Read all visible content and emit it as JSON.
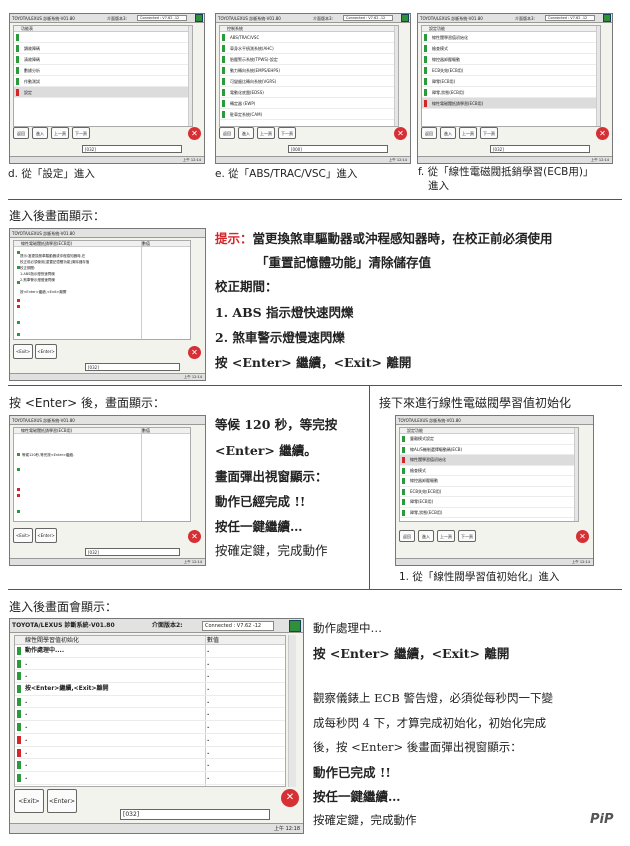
{
  "top_row": {
    "screen_title": "TOYOTA/LEXUS 診斷系統-V01.80",
    "screen_ver_label": "介面版本3:",
    "screen_conn": "Connected : V7.62 -12",
    "screen_d": {
      "header": "功能表",
      "rows": [
        "",
        "讀故障碼",
        "清故障碼",
        "數據分析",
        "作動測試",
        "設定"
      ],
      "selected": 5
    },
    "screen_e": {
      "header": "控制系統",
      "rows": [
        "ABS/TRAC/VSC",
        "車身水平偵測系統(AHC)",
        "胎壓警示系統(TPWS)-設定",
        "動力轉向系統(EMPS/EHPS)",
        "可變齒比轉向系統(VGRS)",
        "電動化底盤(EDSS)",
        "轉定器 (EWP)",
        "駐車定系統(CAM)"
      ],
      "selected": -1
    },
    "screen_f": {
      "header": "設定功能",
      "rows": [
        "線性閥學習值初始化",
        "檢查模式",
        "線控器卸壓驅動",
        "ECB失效(ECB用)",
        "歸零(ECB用)",
        "歸零,狀態(ECB用)",
        "線性電磁閥抵銷學習(ECB用)"
      ],
      "selected": 6
    },
    "buttons": [
      "返回",
      "進入",
      "上一頁",
      "下一頁"
    ],
    "input_value": "[032]",
    "input_value_e": "[000]",
    "status_time": "上午 12:14",
    "caption_d": "d. 從「設定」進入",
    "caption_e": "e. 從「ABS/TRAC/VSC」進入",
    "caption_f_line1": "f. 從「線性電磁閥抵銷學習(ECB用)」",
    "caption_f_line2": "進入"
  },
  "section2": {
    "heading": "進入後畫面顯示：",
    "screen_header": "線性電磁閥抵銷學習(ECB用)",
    "screen_col2": "數值",
    "screen_text": "提示:當更換煞車驅動器或沖程感知器時,在\n校正前必須使用[重置記憶體功能]清除儲存值\n校正期間:\n1.ABS指示燈快速閃爍\n2.煞車警示燈慢速閃爍\n\n按<Enter>繼續,<Exit>離開",
    "screen_buttons": [
      "<Exit>",
      "<Enter>"
    ],
    "tip_label": "提示：",
    "tip_line1": "當更換煞車驅動器或沖程感知器時，在校正前必須使用",
    "tip_line2": "「重置記憶體功能」清除儲存值",
    "p1": "校正期間：",
    "p2": "1. ABS 指示燈快速閃爍",
    "p3": "2. 煞車警示燈慢速閃爍",
    "p4": "按 <Enter> 繼續，<Exit> 離開"
  },
  "section3": {
    "heading": "按 <Enter> 後，畫面顯示：",
    "screen_text": "等候120秒,等完按<Enter>繼續.",
    "l1": "等候 120 秒，等完按",
    "l2": "<Enter> 繼續。",
    "l3": "畫面彈出視窗顯示：",
    "l4": "動作已經完成 !!",
    "l5": "按任一鍵繼續…",
    "l6": "按確定鍵，完成動作"
  },
  "section3b": {
    "heading": "接下來進行線性電磁閥學習值初始化",
    "screen_header": "設定功能",
    "rows": [
      "豐離模式設定",
      "線AL/S機制選擇驅動碼(ECB)",
      "線性閥學習值初始化",
      "檢查模式",
      "線控器卸壓驅動",
      "ECB失效(ECB用)",
      "歸零(ECB用)",
      "歸零,狀態(ECB用)"
    ],
    "selected": 2,
    "caption": "1. 從「線性閥學習值初始化」進入"
  },
  "section4": {
    "heading": "進入後畫面會顯示：",
    "screen_title": "TOYOTA/LEXUS 診斷系統-V01.80",
    "screen_ver_label": "介面版本2:",
    "screen_conn": "Connected : V7.62 -12",
    "screen_header": "線性閥學習值初始化",
    "screen_col2": "數值",
    "screen_rows": [
      "動作處理中....",
      ".",
      ".",
      "按<Enter>繼續,<Exit>離開",
      ".",
      ".",
      ".",
      ".",
      ".",
      ".",
      "."
    ],
    "screen_buttons": [
      "<Exit>",
      "<Enter>"
    ],
    "input_value": "[032]",
    "status_time": "上午 12:18",
    "l1": "動作處理中…",
    "l2": "按 <Enter> 繼續，<Exit> 離開",
    "l3": "觀察儀錶上 ECB 警告燈，必須從每秒閃一下變",
    "l4": "成每秒閃 4 下，才算完成初始化，初始化完成",
    "l5": "後，按 <Enter> 後畫面彈出視窗顯示：",
    "l6": "動作已完成 !!",
    "l7": "按任一鍵繼續…",
    "l8": "按確定鍵，完成動作",
    "logo": "PiP"
  }
}
